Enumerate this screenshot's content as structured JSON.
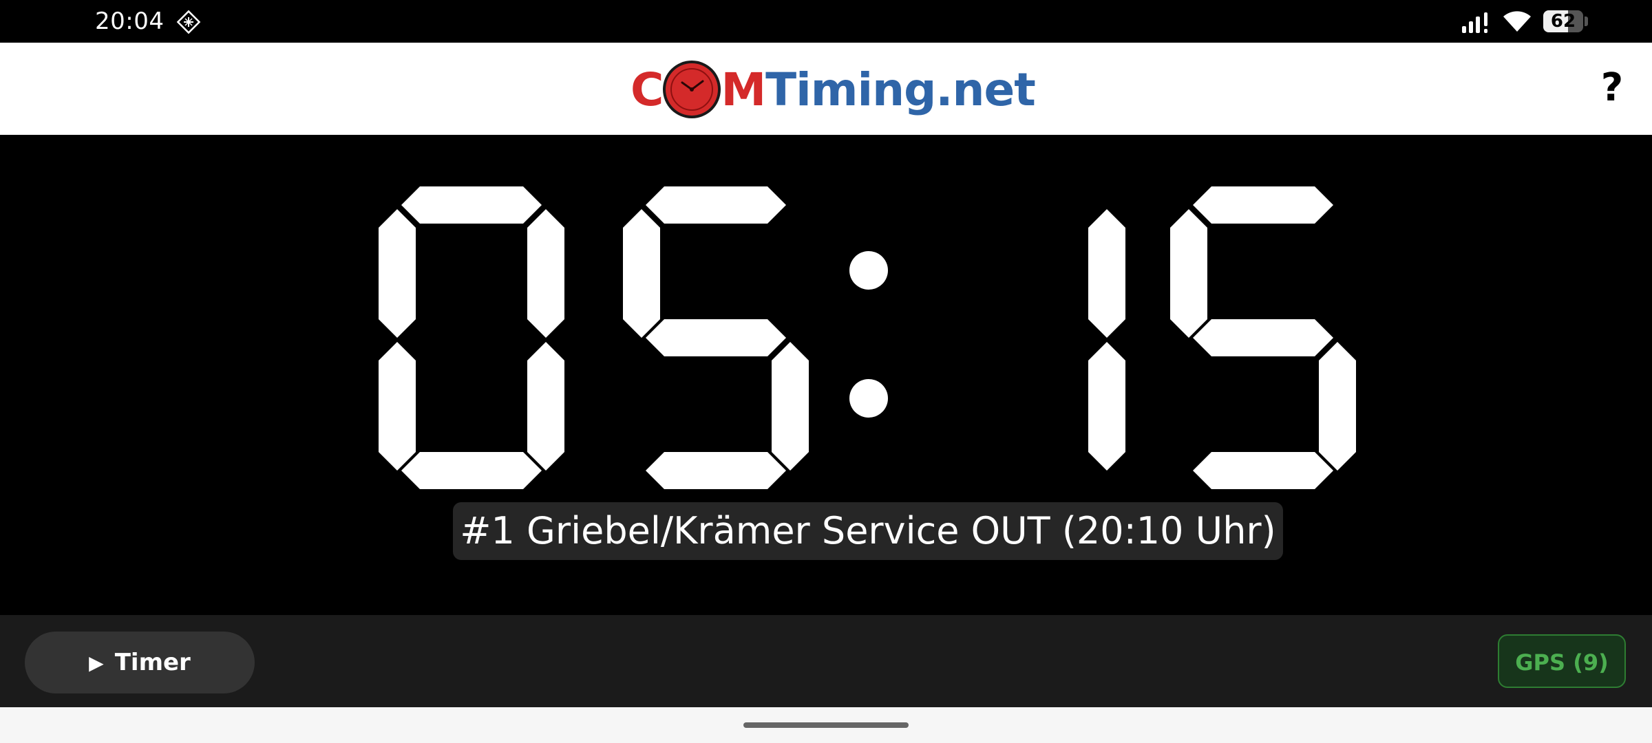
{
  "status_bar": {
    "time": "20:04",
    "icons": [
      "diamond-grid-icon",
      "signal-icon",
      "wifi-icon",
      "battery-icon"
    ],
    "battery_level": "62",
    "battery_fraction": 0.62
  },
  "header": {
    "logo_prefix": "C",
    "logo_mid": "M",
    "logo_suffix": "Timing.net",
    "help_label": "?"
  },
  "clock": {
    "minutes": "05",
    "seconds": "15",
    "separator": ":"
  },
  "info_label": "#1 Griebel/Krämer Service OUT (20:10 Uhr)",
  "bottom_bar": {
    "timer_button_label": "Timer",
    "gps_label": "GPS (9)"
  },
  "colors": {
    "logo_red": "#d42a2a",
    "logo_blue": "#2f65a8",
    "gps_green": "#4caf50",
    "segment_on": "#ffffff"
  }
}
